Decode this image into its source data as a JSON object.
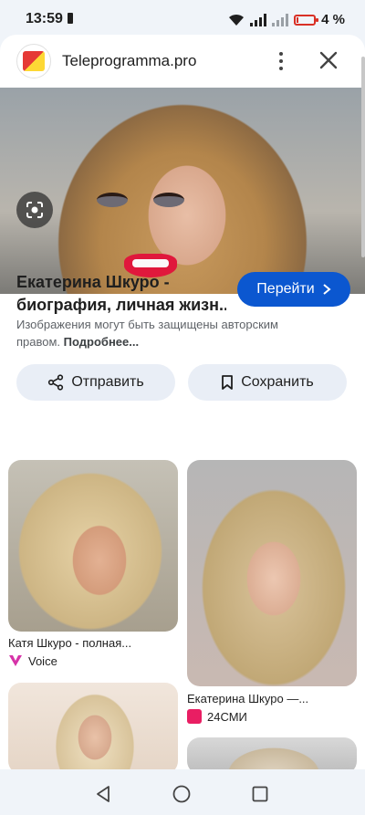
{
  "status": {
    "time": "13:59",
    "battery": "4 %"
  },
  "header": {
    "site_name": "Teleprogramma.pro"
  },
  "result": {
    "title_line1": "Екатерина Шкуро -",
    "title_line2": "биография, личная жизн...",
    "go_label": "Перейти",
    "note_text": "Изображения могут быть защищены авторским правом.",
    "note_more": "Подробнее..."
  },
  "actions": {
    "share_label": "Отправить",
    "save_label": "Сохранить"
  },
  "related": [
    {
      "caption": "Катя Шкуро - полная...",
      "source": "Voice"
    },
    {
      "caption": "Екатерина Шкуро —...",
      "source": "24СМИ"
    }
  ],
  "colors": {
    "accent": "#0b57d0",
    "voice_icon": "#d633a8",
    "smi_icon": "#e91e63"
  }
}
